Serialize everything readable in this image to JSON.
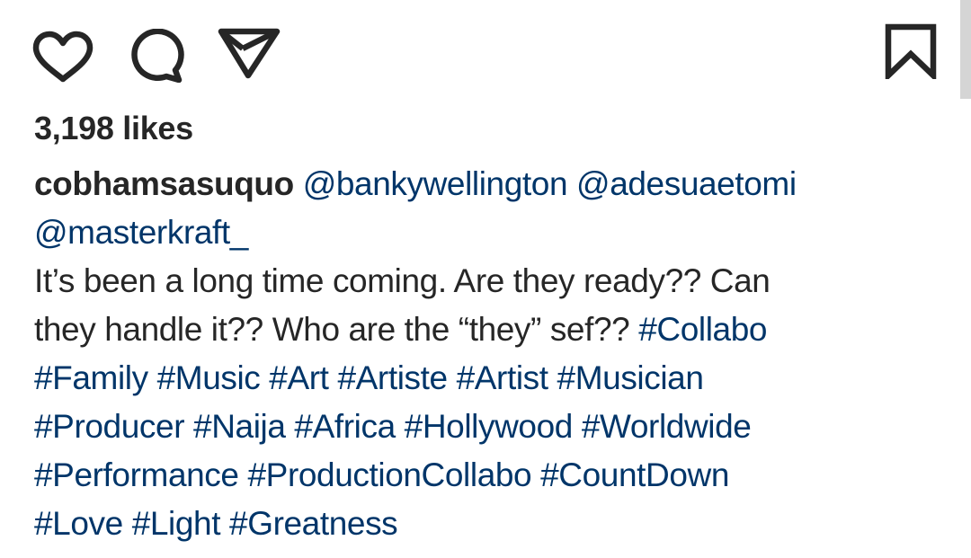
{
  "actions": {
    "like_icon": "heart-icon",
    "comment_icon": "comment-icon",
    "share_icon": "send-icon",
    "save_icon": "bookmark-icon"
  },
  "likes": {
    "label": "3,198 likes"
  },
  "caption": {
    "username": "cobhamsasuquo",
    "mentions": [
      "@bankywellington",
      "@adesuaetomi",
      "@masterkraft_"
    ],
    "text_line1": "It’s been a long time coming. Are they ready?? Can",
    "text_line2": "they handle it?? Who are the “they” sef??",
    "hashtags": [
      "#Collabo",
      "#Family",
      "#Music",
      "#Art",
      "#Artiste",
      "#Artist",
      "#Musician",
      "#Producer",
      "#Naija",
      "#Africa",
      "#Hollywood",
      "#Worldwide",
      "#Performance",
      "#ProductionCollabo",
      "#CountDown",
      "#Love",
      "#Light",
      "#Greatness"
    ]
  },
  "colors": {
    "text": "#262626",
    "link": "#003569",
    "background": "#ffffff",
    "scrollbar": "#d5d5d5"
  }
}
